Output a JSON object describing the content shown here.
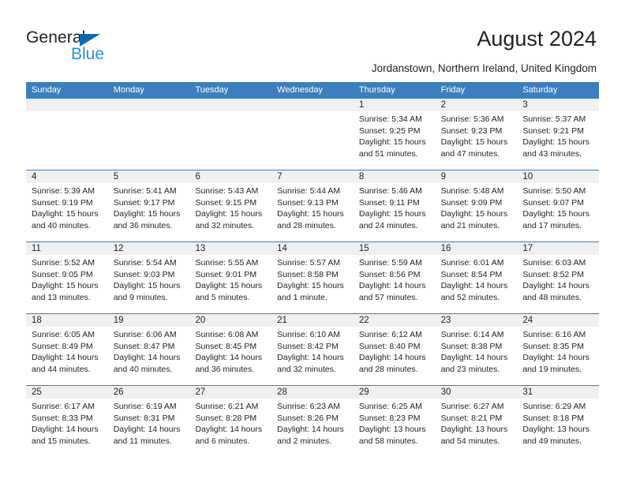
{
  "brand": {
    "name_top": "General",
    "name_bottom": "Blue",
    "accent_color": "#1266ae",
    "accent_color_light": "#2f8fd4"
  },
  "header": {
    "title": "August 2024",
    "subtitle": "Jordanstown, Northern Ireland, United Kingdom"
  },
  "calendar": {
    "header_bg": "#3c7ebf",
    "day_band_bg": "#f0f0f0",
    "weekdays": [
      "Sunday",
      "Monday",
      "Tuesday",
      "Wednesday",
      "Thursday",
      "Friday",
      "Saturday"
    ],
    "weeks": [
      [
        {
          "day": "",
          "sunrise": "",
          "sunset": "",
          "daylight1": "",
          "daylight2": ""
        },
        {
          "day": "",
          "sunrise": "",
          "sunset": "",
          "daylight1": "",
          "daylight2": ""
        },
        {
          "day": "",
          "sunrise": "",
          "sunset": "",
          "daylight1": "",
          "daylight2": ""
        },
        {
          "day": "",
          "sunrise": "",
          "sunset": "",
          "daylight1": "",
          "daylight2": ""
        },
        {
          "day": "1",
          "sunrise": "Sunrise: 5:34 AM",
          "sunset": "Sunset: 9:25 PM",
          "daylight1": "Daylight: 15 hours",
          "daylight2": "and 51 minutes."
        },
        {
          "day": "2",
          "sunrise": "Sunrise: 5:36 AM",
          "sunset": "Sunset: 9:23 PM",
          "daylight1": "Daylight: 15 hours",
          "daylight2": "and 47 minutes."
        },
        {
          "day": "3",
          "sunrise": "Sunrise: 5:37 AM",
          "sunset": "Sunset: 9:21 PM",
          "daylight1": "Daylight: 15 hours",
          "daylight2": "and 43 minutes."
        }
      ],
      [
        {
          "day": "4",
          "sunrise": "Sunrise: 5:39 AM",
          "sunset": "Sunset: 9:19 PM",
          "daylight1": "Daylight: 15 hours",
          "daylight2": "and 40 minutes."
        },
        {
          "day": "5",
          "sunrise": "Sunrise: 5:41 AM",
          "sunset": "Sunset: 9:17 PM",
          "daylight1": "Daylight: 15 hours",
          "daylight2": "and 36 minutes."
        },
        {
          "day": "6",
          "sunrise": "Sunrise: 5:43 AM",
          "sunset": "Sunset: 9:15 PM",
          "daylight1": "Daylight: 15 hours",
          "daylight2": "and 32 minutes."
        },
        {
          "day": "7",
          "sunrise": "Sunrise: 5:44 AM",
          "sunset": "Sunset: 9:13 PM",
          "daylight1": "Daylight: 15 hours",
          "daylight2": "and 28 minutes."
        },
        {
          "day": "8",
          "sunrise": "Sunrise: 5:46 AM",
          "sunset": "Sunset: 9:11 PM",
          "daylight1": "Daylight: 15 hours",
          "daylight2": "and 24 minutes."
        },
        {
          "day": "9",
          "sunrise": "Sunrise: 5:48 AM",
          "sunset": "Sunset: 9:09 PM",
          "daylight1": "Daylight: 15 hours",
          "daylight2": "and 21 minutes."
        },
        {
          "day": "10",
          "sunrise": "Sunrise: 5:50 AM",
          "sunset": "Sunset: 9:07 PM",
          "daylight1": "Daylight: 15 hours",
          "daylight2": "and 17 minutes."
        }
      ],
      [
        {
          "day": "11",
          "sunrise": "Sunrise: 5:52 AM",
          "sunset": "Sunset: 9:05 PM",
          "daylight1": "Daylight: 15 hours",
          "daylight2": "and 13 minutes."
        },
        {
          "day": "12",
          "sunrise": "Sunrise: 5:54 AM",
          "sunset": "Sunset: 9:03 PM",
          "daylight1": "Daylight: 15 hours",
          "daylight2": "and 9 minutes."
        },
        {
          "day": "13",
          "sunrise": "Sunrise: 5:55 AM",
          "sunset": "Sunset: 9:01 PM",
          "daylight1": "Daylight: 15 hours",
          "daylight2": "and 5 minutes."
        },
        {
          "day": "14",
          "sunrise": "Sunrise: 5:57 AM",
          "sunset": "Sunset: 8:58 PM",
          "daylight1": "Daylight: 15 hours",
          "daylight2": "and 1 minute."
        },
        {
          "day": "15",
          "sunrise": "Sunrise: 5:59 AM",
          "sunset": "Sunset: 8:56 PM",
          "daylight1": "Daylight: 14 hours",
          "daylight2": "and 57 minutes."
        },
        {
          "day": "16",
          "sunrise": "Sunrise: 6:01 AM",
          "sunset": "Sunset: 8:54 PM",
          "daylight1": "Daylight: 14 hours",
          "daylight2": "and 52 minutes."
        },
        {
          "day": "17",
          "sunrise": "Sunrise: 6:03 AM",
          "sunset": "Sunset: 8:52 PM",
          "daylight1": "Daylight: 14 hours",
          "daylight2": "and 48 minutes."
        }
      ],
      [
        {
          "day": "18",
          "sunrise": "Sunrise: 6:05 AM",
          "sunset": "Sunset: 8:49 PM",
          "daylight1": "Daylight: 14 hours",
          "daylight2": "and 44 minutes."
        },
        {
          "day": "19",
          "sunrise": "Sunrise: 6:06 AM",
          "sunset": "Sunset: 8:47 PM",
          "daylight1": "Daylight: 14 hours",
          "daylight2": "and 40 minutes."
        },
        {
          "day": "20",
          "sunrise": "Sunrise: 6:08 AM",
          "sunset": "Sunset: 8:45 PM",
          "daylight1": "Daylight: 14 hours",
          "daylight2": "and 36 minutes."
        },
        {
          "day": "21",
          "sunrise": "Sunrise: 6:10 AM",
          "sunset": "Sunset: 8:42 PM",
          "daylight1": "Daylight: 14 hours",
          "daylight2": "and 32 minutes."
        },
        {
          "day": "22",
          "sunrise": "Sunrise: 6:12 AM",
          "sunset": "Sunset: 8:40 PM",
          "daylight1": "Daylight: 14 hours",
          "daylight2": "and 28 minutes."
        },
        {
          "day": "23",
          "sunrise": "Sunrise: 6:14 AM",
          "sunset": "Sunset: 8:38 PM",
          "daylight1": "Daylight: 14 hours",
          "daylight2": "and 23 minutes."
        },
        {
          "day": "24",
          "sunrise": "Sunrise: 6:16 AM",
          "sunset": "Sunset: 8:35 PM",
          "daylight1": "Daylight: 14 hours",
          "daylight2": "and 19 minutes."
        }
      ],
      [
        {
          "day": "25",
          "sunrise": "Sunrise: 6:17 AM",
          "sunset": "Sunset: 8:33 PM",
          "daylight1": "Daylight: 14 hours",
          "daylight2": "and 15 minutes."
        },
        {
          "day": "26",
          "sunrise": "Sunrise: 6:19 AM",
          "sunset": "Sunset: 8:31 PM",
          "daylight1": "Daylight: 14 hours",
          "daylight2": "and 11 minutes."
        },
        {
          "day": "27",
          "sunrise": "Sunrise: 6:21 AM",
          "sunset": "Sunset: 8:28 PM",
          "daylight1": "Daylight: 14 hours",
          "daylight2": "and 6 minutes."
        },
        {
          "day": "28",
          "sunrise": "Sunrise: 6:23 AM",
          "sunset": "Sunset: 8:26 PM",
          "daylight1": "Daylight: 14 hours",
          "daylight2": "and 2 minutes."
        },
        {
          "day": "29",
          "sunrise": "Sunrise: 6:25 AM",
          "sunset": "Sunset: 8:23 PM",
          "daylight1": "Daylight: 13 hours",
          "daylight2": "and 58 minutes."
        },
        {
          "day": "30",
          "sunrise": "Sunrise: 6:27 AM",
          "sunset": "Sunset: 8:21 PM",
          "daylight1": "Daylight: 13 hours",
          "daylight2": "and 54 minutes."
        },
        {
          "day": "31",
          "sunrise": "Sunrise: 6:29 AM",
          "sunset": "Sunset: 8:18 PM",
          "daylight1": "Daylight: 13 hours",
          "daylight2": "and 49 minutes."
        }
      ]
    ]
  }
}
